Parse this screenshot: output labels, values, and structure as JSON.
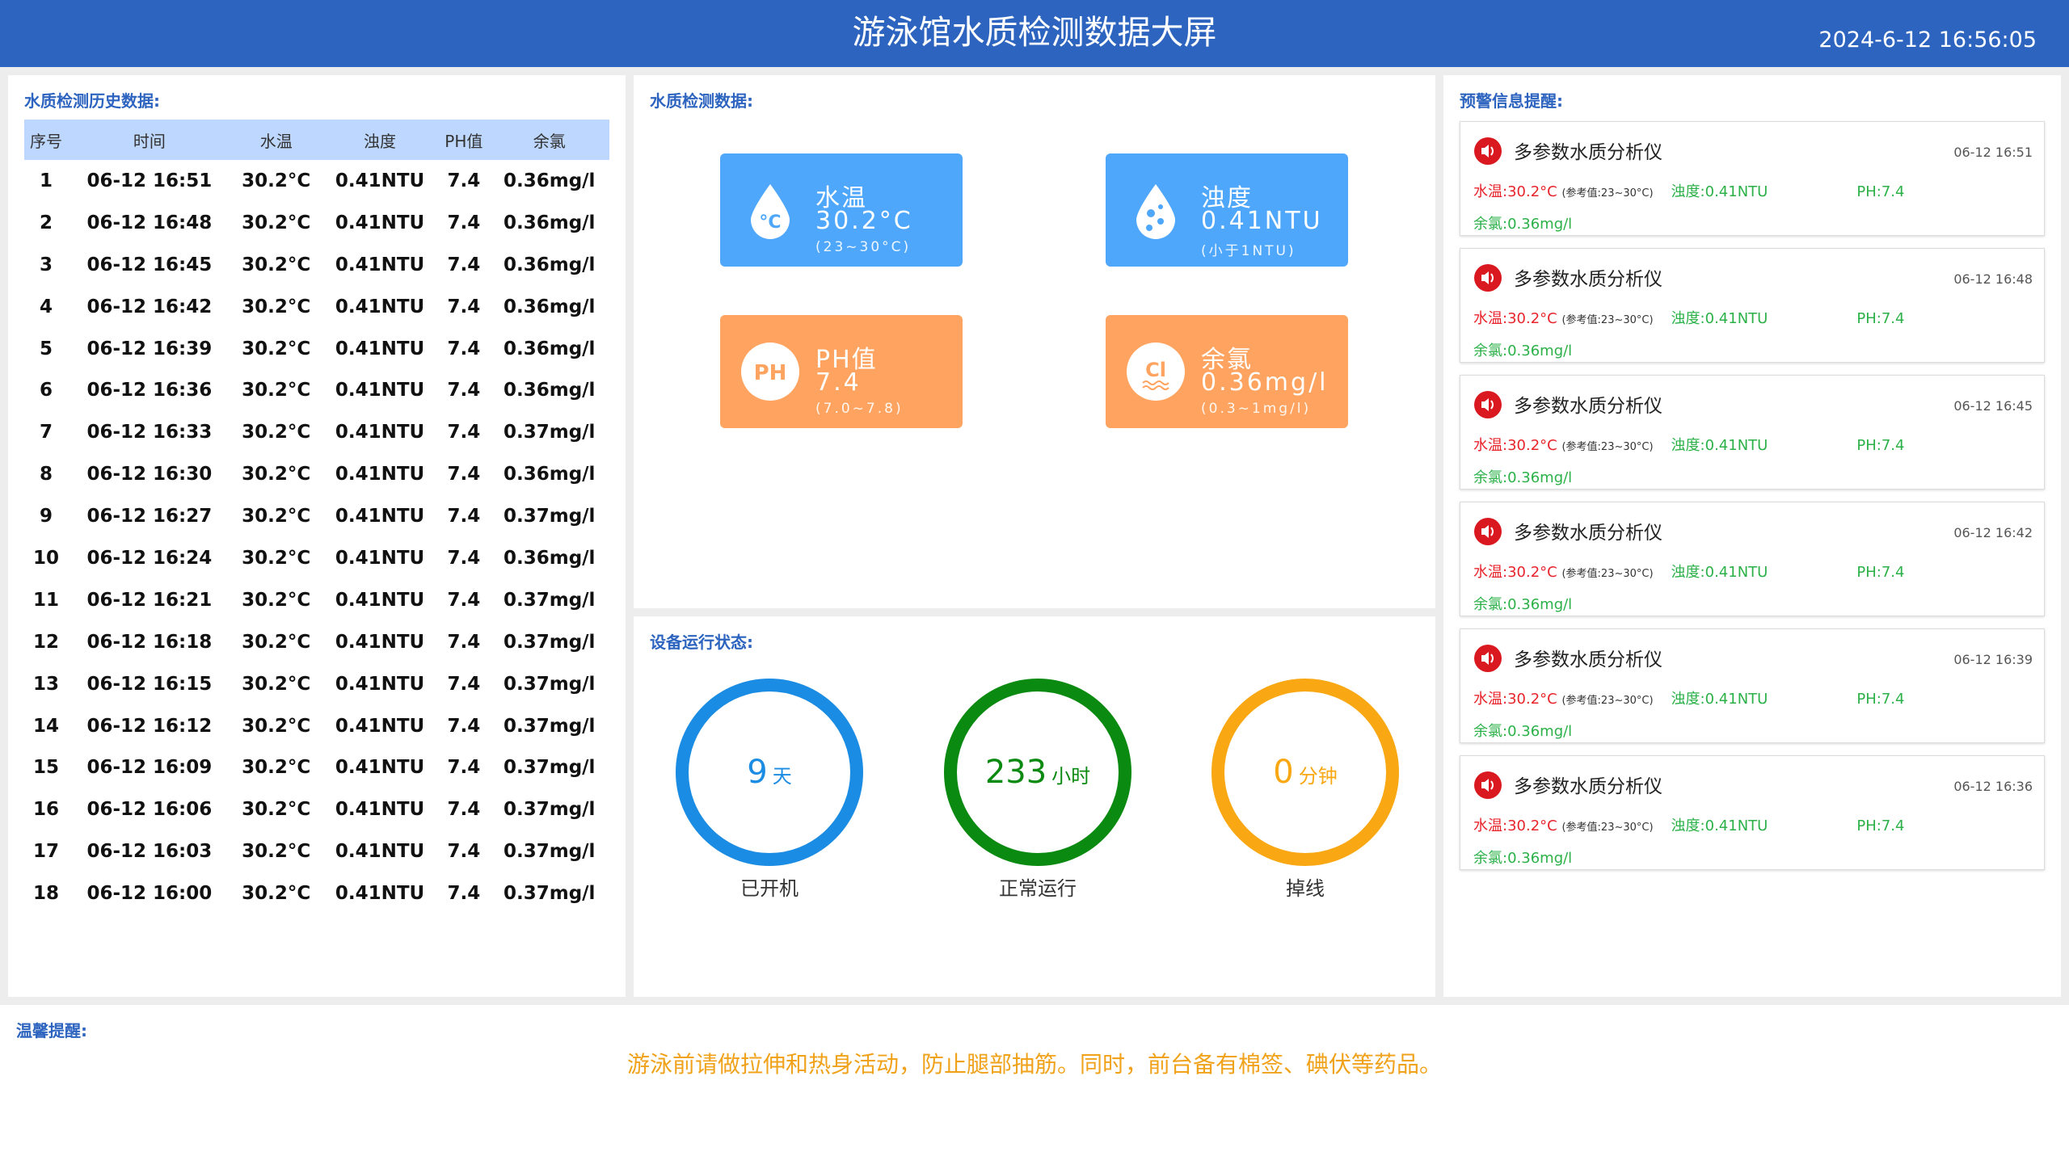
{
  "header": {
    "title": "游泳馆水质检测数据大屏",
    "datetime": "2024-6-12 16:56:05"
  },
  "history": {
    "title": "水质检测历史数据:",
    "columns": [
      "序号",
      "时间",
      "水温",
      "浊度",
      "PH值",
      "余氯"
    ],
    "rows": [
      [
        "1",
        "06-12 16:51",
        "30.2°C",
        "0.41NTU",
        "7.4",
        "0.36mg/l"
      ],
      [
        "2",
        "06-12 16:48",
        "30.2°C",
        "0.41NTU",
        "7.4",
        "0.36mg/l"
      ],
      [
        "3",
        "06-12 16:45",
        "30.2°C",
        "0.41NTU",
        "7.4",
        "0.36mg/l"
      ],
      [
        "4",
        "06-12 16:42",
        "30.2°C",
        "0.41NTU",
        "7.4",
        "0.36mg/l"
      ],
      [
        "5",
        "06-12 16:39",
        "30.2°C",
        "0.41NTU",
        "7.4",
        "0.36mg/l"
      ],
      [
        "6",
        "06-12 16:36",
        "30.2°C",
        "0.41NTU",
        "7.4",
        "0.36mg/l"
      ],
      [
        "7",
        "06-12 16:33",
        "30.2°C",
        "0.41NTU",
        "7.4",
        "0.37mg/l"
      ],
      [
        "8",
        "06-12 16:30",
        "30.2°C",
        "0.41NTU",
        "7.4",
        "0.36mg/l"
      ],
      [
        "9",
        "06-12 16:27",
        "30.2°C",
        "0.41NTU",
        "7.4",
        "0.37mg/l"
      ],
      [
        "10",
        "06-12 16:24",
        "30.2°C",
        "0.41NTU",
        "7.4",
        "0.36mg/l"
      ],
      [
        "11",
        "06-12 16:21",
        "30.2°C",
        "0.41NTU",
        "7.4",
        "0.37mg/l"
      ],
      [
        "12",
        "06-12 16:18",
        "30.2°C",
        "0.41NTU",
        "7.4",
        "0.37mg/l"
      ],
      [
        "13",
        "06-12 16:15",
        "30.2°C",
        "0.41NTU",
        "7.4",
        "0.37mg/l"
      ],
      [
        "14",
        "06-12 16:12",
        "30.2°C",
        "0.41NTU",
        "7.4",
        "0.37mg/l"
      ],
      [
        "15",
        "06-12 16:09",
        "30.2°C",
        "0.41NTU",
        "7.4",
        "0.37mg/l"
      ],
      [
        "16",
        "06-12 16:06",
        "30.2°C",
        "0.41NTU",
        "7.4",
        "0.37mg/l"
      ],
      [
        "17",
        "06-12 16:03",
        "30.2°C",
        "0.41NTU",
        "7.4",
        "0.37mg/l"
      ],
      [
        "18",
        "06-12 16:00",
        "30.2°C",
        "0.41NTU",
        "7.4",
        "0.37mg/l"
      ]
    ]
  },
  "current": {
    "title": "水质检测数据:",
    "cards": [
      {
        "label": "水温",
        "value": "30.2°C",
        "range": "(23~30°C)",
        "icon": "water-temperature-icon",
        "color": "#4fa7fc"
      },
      {
        "label": "浊度",
        "value": "0.41NTU",
        "range": "(小于1NTU)",
        "icon": "turbidity-icon",
        "color": "#4fa7fc"
      },
      {
        "label": "PH值",
        "value": "7.4",
        "range": "(7.0~7.8)",
        "icon": "ph-icon",
        "color": "#ffa460"
      },
      {
        "label": "余氯",
        "value": "0.36mg/l",
        "range": "(0.3~1mg/l)",
        "icon": "chlorine-icon",
        "color": "#ffa460"
      }
    ]
  },
  "device": {
    "title": "设备运行状态:",
    "items": [
      {
        "value": "9",
        "unit": "天",
        "label": "已开机",
        "color": "#1b8ce3"
      },
      {
        "value": "233",
        "unit": "小时",
        "label": "正常运行",
        "color": "#0a8a10"
      },
      {
        "value": "0",
        "unit": "分钟",
        "label": "掉线",
        "color": "#f9a712"
      }
    ]
  },
  "alerts": {
    "title": "预警信息提醒:",
    "temp_label": "水温:",
    "temp_ref": "(参考值:23~30°C)",
    "turb_label": "浊度:",
    "ph_label": "PH:",
    "chlorine_label": "余氯:",
    "items": [
      {
        "name": "多参数水质分析仪",
        "time": "06-12 16:51",
        "temp": "30.2°C",
        "turb": "0.41NTU",
        "ph": "7.4",
        "chlorine": "0.36mg/l"
      },
      {
        "name": "多参数水质分析仪",
        "time": "06-12 16:48",
        "temp": "30.2°C",
        "turb": "0.41NTU",
        "ph": "7.4",
        "chlorine": "0.36mg/l"
      },
      {
        "name": "多参数水质分析仪",
        "time": "06-12 16:45",
        "temp": "30.2°C",
        "turb": "0.41NTU",
        "ph": "7.4",
        "chlorine": "0.36mg/l"
      },
      {
        "name": "多参数水质分析仪",
        "time": "06-12 16:42",
        "temp": "30.2°C",
        "turb": "0.41NTU",
        "ph": "7.4",
        "chlorine": "0.36mg/l"
      },
      {
        "name": "多参数水质分析仪",
        "time": "06-12 16:39",
        "temp": "30.2°C",
        "turb": "0.41NTU",
        "ph": "7.4",
        "chlorine": "0.36mg/l"
      },
      {
        "name": "多参数水质分析仪",
        "time": "06-12 16:36",
        "temp": "30.2°C",
        "turb": "0.41NTU",
        "ph": "7.4",
        "chlorine": "0.36mg/l"
      }
    ]
  },
  "footer": {
    "title": "温馨提醒:",
    "message": "游泳前请做拉伸和热身活动，防止腿部抽筋。同时，前台备有棉签、碘伏等药品。"
  },
  "colors": {
    "header_bg": "#2d64bf",
    "table_header_bg": "#bdd7ff",
    "alert_red": "#e8242c",
    "alert_green": "#2bb148",
    "footer_text": "#f0a21a"
  }
}
